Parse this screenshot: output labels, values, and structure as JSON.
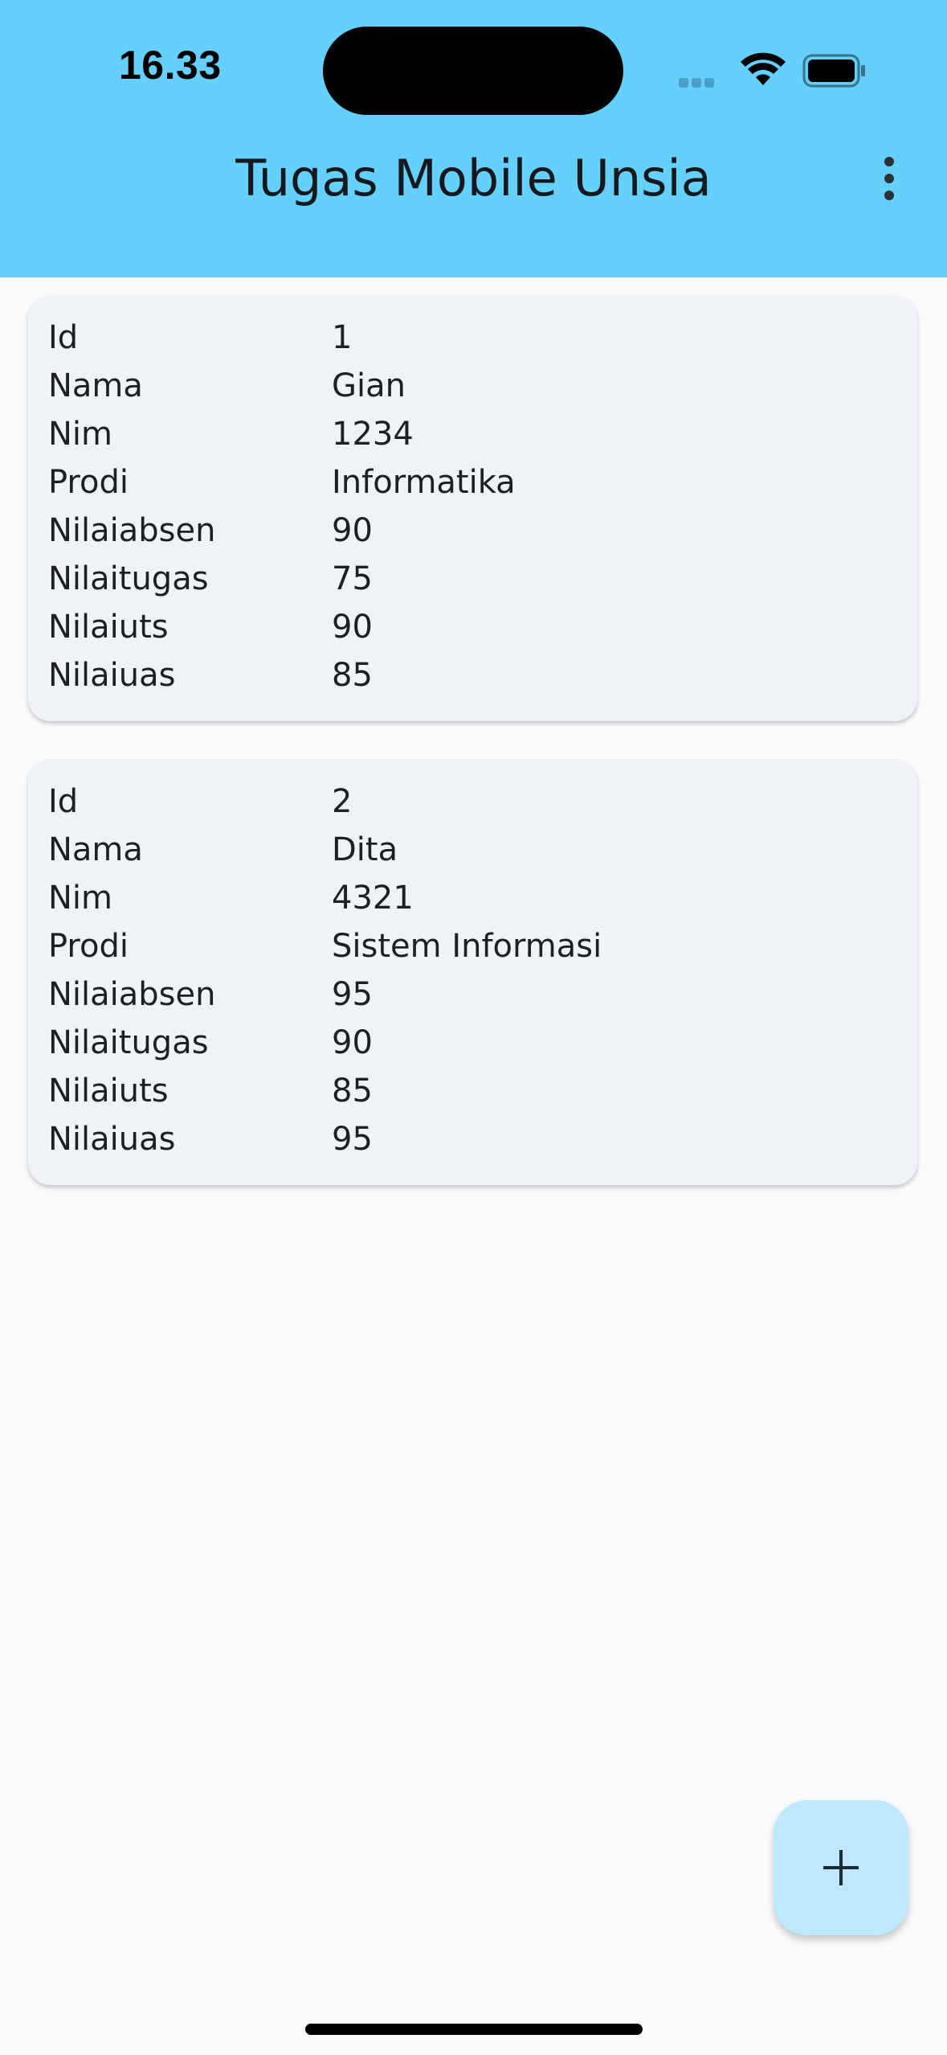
{
  "status_bar": {
    "time": "16.33"
  },
  "app_bar": {
    "title": "Tugas Mobile Unsia",
    "background": "#66d0fd"
  },
  "icons": {
    "menu": "more-vert-icon",
    "add": "plus-icon",
    "wifi": "wifi-icon",
    "battery": "battery-icon",
    "signal": "cellular-signal-icon"
  },
  "students": [
    {
      "rows": [
        {
          "label": "Id",
          "value": "1"
        },
        {
          "label": "Nama",
          "value": "Gian"
        },
        {
          "label": "Nim",
          "value": "1234"
        },
        {
          "label": "Prodi",
          "value": "Informatika"
        },
        {
          "label": "Nilaiabsen",
          "value": "90"
        },
        {
          "label": "Nilaitugas",
          "value": "75"
        },
        {
          "label": "Nilaiuts",
          "value": "90"
        },
        {
          "label": "Nilaiuas",
          "value": "85"
        }
      ]
    },
    {
      "rows": [
        {
          "label": "Id",
          "value": "2"
        },
        {
          "label": "Nama",
          "value": "Dita"
        },
        {
          "label": "Nim",
          "value": "4321"
        },
        {
          "label": "Prodi",
          "value": "Sistem Informasi"
        },
        {
          "label": "Nilaiabsen",
          "value": "95"
        },
        {
          "label": "Nilaitugas",
          "value": "90"
        },
        {
          "label": "Nilaiuts",
          "value": "85"
        },
        {
          "label": "Nilaiuas",
          "value": "95"
        }
      ]
    }
  ],
  "colors": {
    "card_background": "#eff3f7",
    "fab_background": "#bde8fd",
    "page_background": "#f9fbfd"
  }
}
